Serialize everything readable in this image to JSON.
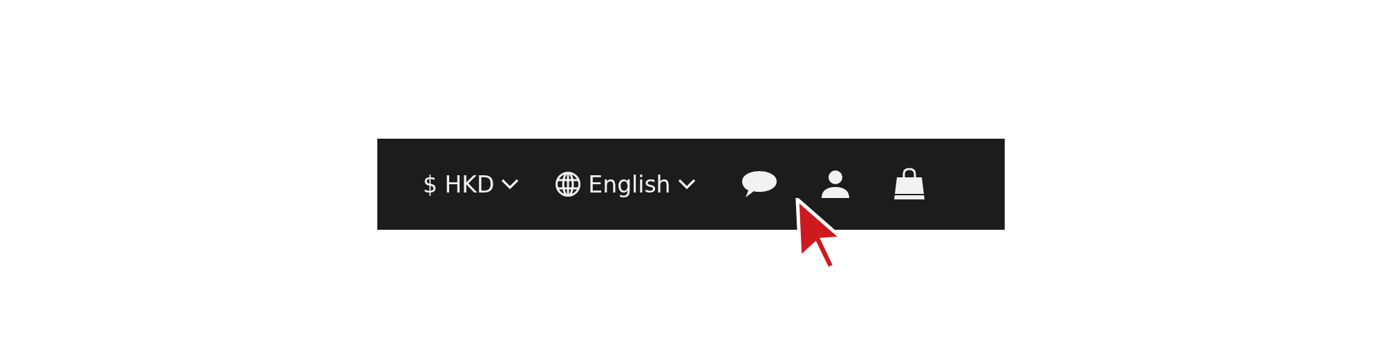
{
  "top_bar": {
    "currency": {
      "label": "$ HKD"
    },
    "language": {
      "label": "English"
    },
    "icons": [
      {
        "kind": "chat"
      },
      {
        "kind": "account"
      },
      {
        "kind": "cart"
      }
    ]
  }
}
